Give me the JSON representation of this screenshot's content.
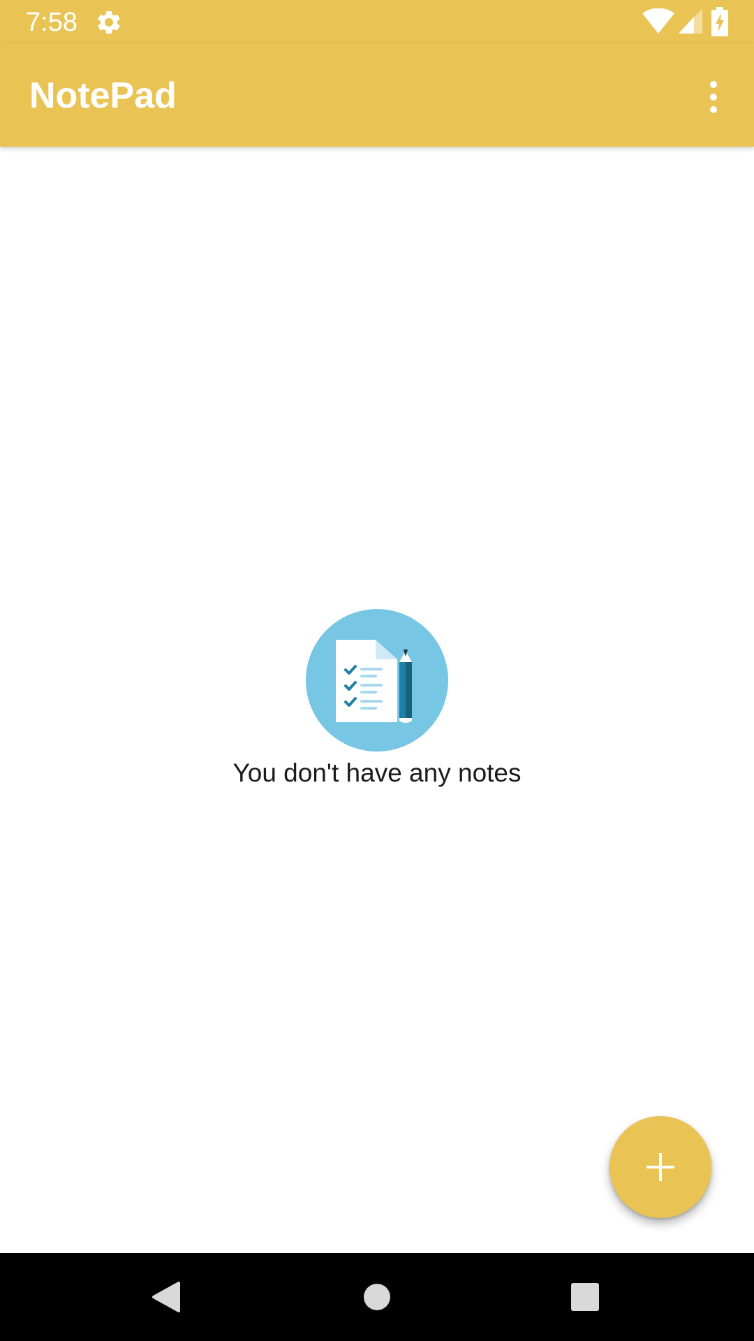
{
  "status_bar": {
    "time": "7:58",
    "icons": [
      "settings-icon",
      "wifi-icon",
      "cell-signal-icon",
      "battery-charging-icon"
    ]
  },
  "app_bar": {
    "title": "NotePad",
    "menu_icon": "more-vert-icon"
  },
  "empty_state": {
    "illustration": "notes-checklist-pencil-icon",
    "message": "You don't have any notes"
  },
  "fab": {
    "icon": "plus-icon"
  },
  "nav_bar": {
    "buttons": [
      "back-icon",
      "home-icon",
      "recents-icon"
    ]
  },
  "colors": {
    "accent": "#E9C454",
    "illustration_bg": "#77C6E4",
    "background": "#FFFFFF",
    "nav_bar": "#000000"
  }
}
